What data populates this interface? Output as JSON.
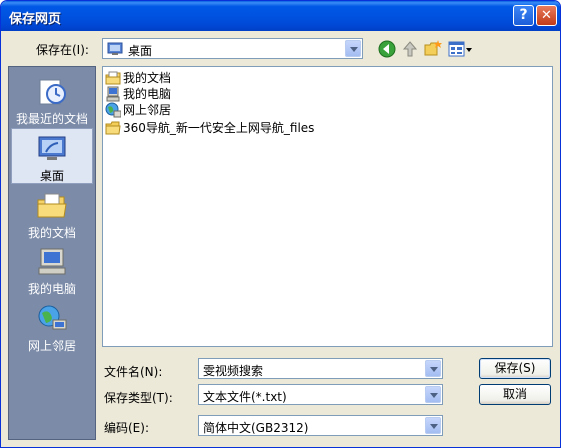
{
  "window": {
    "title": "保存网页",
    "help_glyph": "?",
    "close_glyph": "✕"
  },
  "save_in": {
    "label": "保存在(I):",
    "value": "桌面"
  },
  "places": [
    {
      "label": "我最近的文档",
      "icon": "recent-documents-icon"
    },
    {
      "label": "桌面",
      "icon": "desktop-icon",
      "selected": true
    },
    {
      "label": "我的文档",
      "icon": "my-documents-icon"
    },
    {
      "label": "我的电脑",
      "icon": "my-computer-icon"
    },
    {
      "label": "网上邻居",
      "icon": "network-places-icon"
    }
  ],
  "files": [
    {
      "name": "我的文档",
      "icon": "my-documents-icon"
    },
    {
      "name": "我的电脑",
      "icon": "my-computer-icon"
    },
    {
      "name": "网上邻居",
      "icon": "network-places-icon"
    },
    {
      "name": "360导航_新一代安全上网导航_files",
      "icon": "folder-icon"
    }
  ],
  "form": {
    "filename_label": "文件名(N):",
    "filename_value": "雯视频搜索",
    "filetype_label": "保存类型(T):",
    "filetype_value": "文本文件(*.txt)",
    "encoding_label": "编码(E):",
    "encoding_value": "简体中文(GB2312)"
  },
  "buttons": {
    "save": "保存(S)",
    "cancel": "取消"
  },
  "colors": {
    "titlebar": "#0054e3",
    "places_bg": "#7b8ba8",
    "dialog_bg": "#ece9d8"
  }
}
